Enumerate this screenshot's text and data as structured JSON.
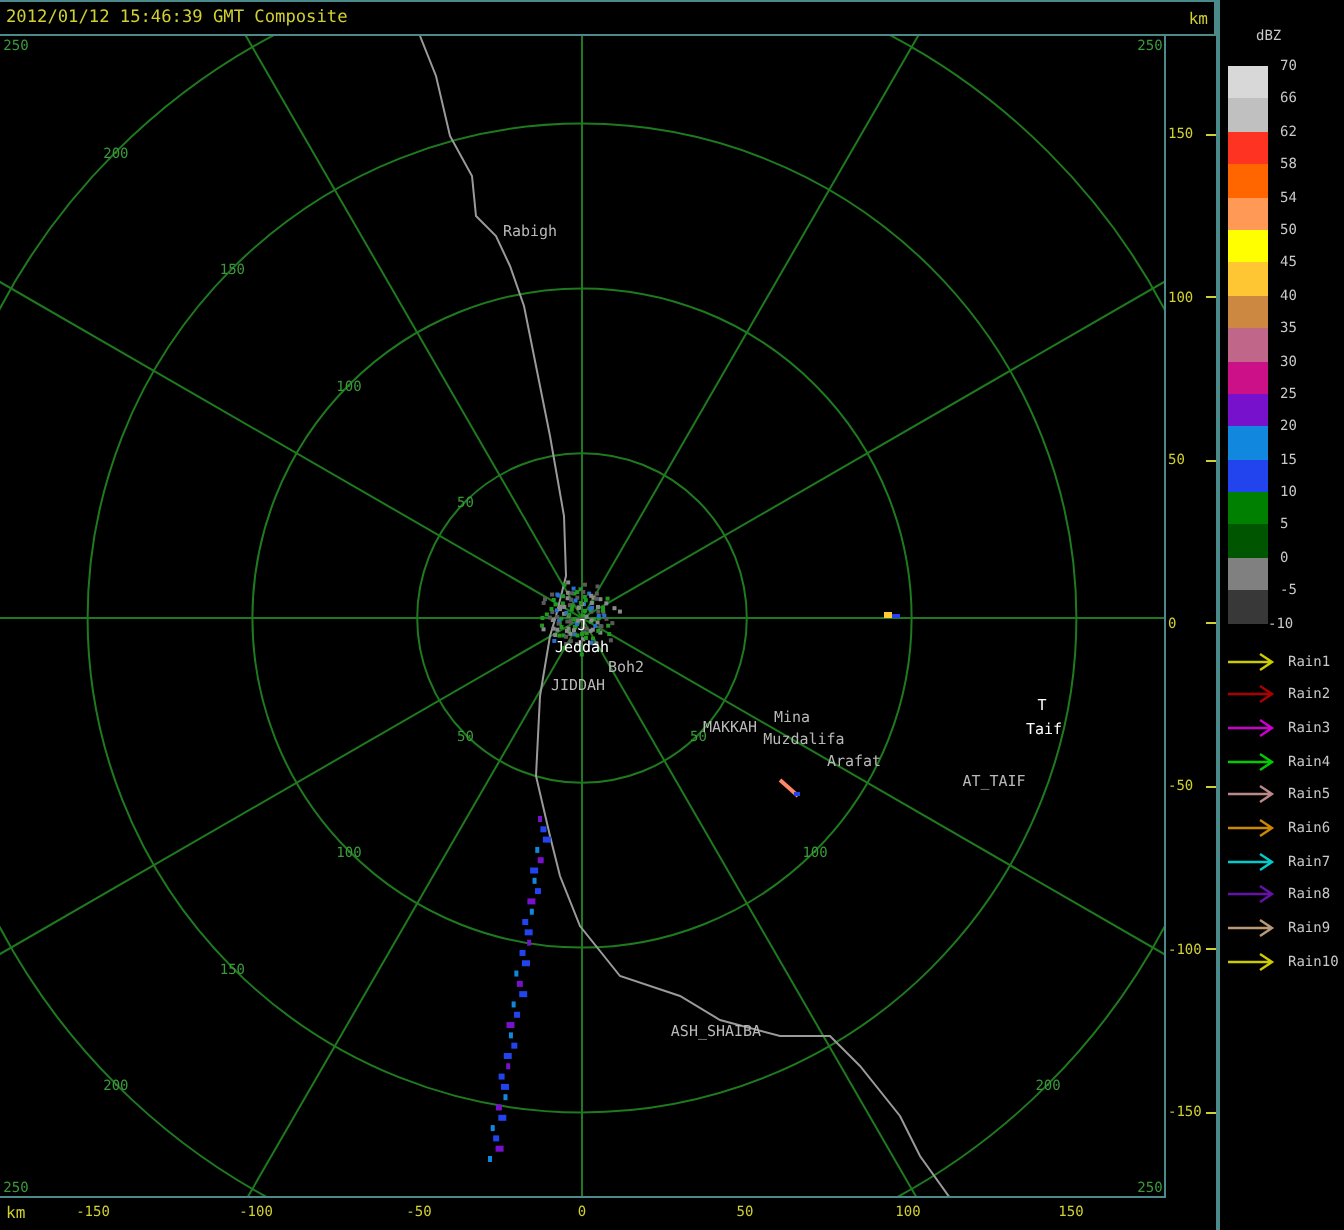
{
  "header": {
    "title": "2012/01/12 15:46:39 GMT Composite"
  },
  "map": {
    "range_labels": [
      "250",
      "250",
      "200",
      "150",
      "100",
      "50",
      "50",
      "50",
      "100",
      "100",
      "150",
      "200",
      "200",
      "250",
      "250"
    ],
    "places": [
      {
        "label": "Rabigh",
        "kind": "town"
      },
      {
        "label": "J",
        "kind": "site"
      },
      {
        "label": "Jeddah",
        "kind": "site"
      },
      {
        "label": "Boh2",
        "kind": "town"
      },
      {
        "label": "JIDDAH",
        "kind": "town"
      },
      {
        "label": "MAKKAH",
        "kind": "town"
      },
      {
        "label": "Mina",
        "kind": "town"
      },
      {
        "label": "Muzdalifa",
        "kind": "town"
      },
      {
        "label": "Arafat",
        "kind": "town"
      },
      {
        "label": "T",
        "kind": "site"
      },
      {
        "label": "Taif",
        "kind": "site"
      },
      {
        "label": "AT_TAIF",
        "kind": "town"
      },
      {
        "label": "ASH_SHAIBA",
        "kind": "town"
      }
    ]
  },
  "y_axis": {
    "unit": "km",
    "ticks": [
      "150",
      "100",
      "50",
      "0",
      "-50",
      "-100",
      "-150"
    ]
  },
  "x_axis": {
    "unit": "km",
    "ticks": [
      "-150",
      "-100",
      "-50",
      "0",
      "50",
      "100",
      "150"
    ]
  },
  "legend": {
    "title": "dBZ",
    "scale": [
      {
        "value": "70",
        "color": "#d8d8d8"
      },
      {
        "value": "66",
        "color": "#c0c0c0"
      },
      {
        "value": "62",
        "color": "#ff3322"
      },
      {
        "value": "58",
        "color": "#ff6600"
      },
      {
        "value": "54",
        "color": "#ff9955"
      },
      {
        "value": "50",
        "color": "#ffff00"
      },
      {
        "value": "45",
        "color": "#ffc633"
      },
      {
        "value": "40",
        "color": "#cc8840"
      },
      {
        "value": "35",
        "color": "#c06688"
      },
      {
        "value": "30",
        "color": "#cc1188"
      },
      {
        "value": "25",
        "color": "#7711cc"
      },
      {
        "value": "20",
        "color": "#1188dd"
      },
      {
        "value": "15",
        "color": "#2244ee"
      },
      {
        "value": "10",
        "color": "#008000"
      },
      {
        "value": "5",
        "color": "#005500"
      },
      {
        "value": "0",
        "color": "#808080"
      },
      {
        "value": "-5",
        "color": "#383838"
      }
    ],
    "scale_end": "-10",
    "tracks": [
      {
        "label": "Rain1",
        "color": "#cccc00"
      },
      {
        "label": "Rain2",
        "color": "#aa0000"
      },
      {
        "label": "Rain3",
        "color": "#cc00cc"
      },
      {
        "label": "Rain4",
        "color": "#00cc00"
      },
      {
        "label": "Rain5",
        "color": "#bb8888"
      },
      {
        "label": "Rain6",
        "color": "#cc8800"
      },
      {
        "label": "Rain7",
        "color": "#00cccc"
      },
      {
        "label": "Rain8",
        "color": "#6611aa"
      },
      {
        "label": "Rain9",
        "color": "#bb9977"
      },
      {
        "label": "Rain10",
        "color": "#cccc00"
      }
    ]
  }
}
